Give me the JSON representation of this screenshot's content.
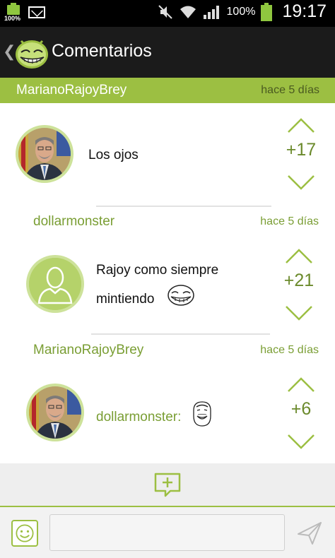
{
  "status_bar": {
    "battery_small_label": "100%",
    "battery_percent": "100%",
    "time": "19:17",
    "icons": [
      "battery-icon",
      "gmail-icon",
      "mute-icon",
      "wifi-icon",
      "signal-icon",
      "battery-icon"
    ]
  },
  "action_bar": {
    "back_icon": "chevron-left-icon",
    "logo_icon": "trollface-logo-icon",
    "title": "Comentarios"
  },
  "post_header": {
    "author": "MarianoRajoyBrey",
    "time": "hace 5 días"
  },
  "comments": [
    {
      "text": "Los ojos",
      "score": "+17",
      "avatar": "rajoy-photo"
    },
    {
      "author": "dollarmonster",
      "time": "hace 5 días",
      "text_line1": "Rajoy como siempre",
      "text_line2": "mintiendo",
      "emoji": "trollface-emoji-icon",
      "score": "+21",
      "avatar": "default-user-icon"
    },
    {
      "author": "MarianoRajoyBrey",
      "time": "hace 5 días",
      "text": "dollarmonster:",
      "emoji": "yao-ming-face-icon",
      "score": "+6",
      "avatar": "rajoy-photo"
    }
  ],
  "input": {
    "value": "",
    "placeholder": ""
  },
  "colors": {
    "accent": "#9cbf42",
    "accent_dark": "#6b8a2c",
    "action_bar": "#1b1b1b",
    "status_bar": "#000000"
  }
}
